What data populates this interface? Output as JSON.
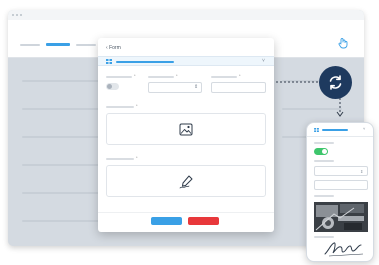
{
  "app": {
    "window_controls": [
      "close",
      "minimize",
      "maximize"
    ],
    "nav_tabs": [
      "",
      "",
      "",
      "",
      "",
      ""
    ],
    "active_tab_index": 1,
    "brand_icon": "hand-pointer-icon"
  },
  "form_dialog": {
    "back_label": "Form",
    "section_icon": "grid-icon",
    "toggle_on": false,
    "stepper_icon": "stepper-arrows-icon",
    "image_placeholder_icon": "image-icon",
    "signature_placeholder_icon": "pen-icon",
    "submit_icon": "check-icon",
    "cancel_icon": "close-icon"
  },
  "sync_icon": "sync-arrows-icon",
  "phone": {
    "toggle_on": true,
    "stepper_icon": "stepper-arrows-icon",
    "photo": "car-engine-photo",
    "signature": "handwritten-signature"
  },
  "colors": {
    "accent_blue": "#3aa0e6",
    "danger_red": "#e8383b",
    "toggle_green": "#3ec66c",
    "dark_circle": "#1e3a5f",
    "desktop_bg": "#cdd4dc"
  }
}
